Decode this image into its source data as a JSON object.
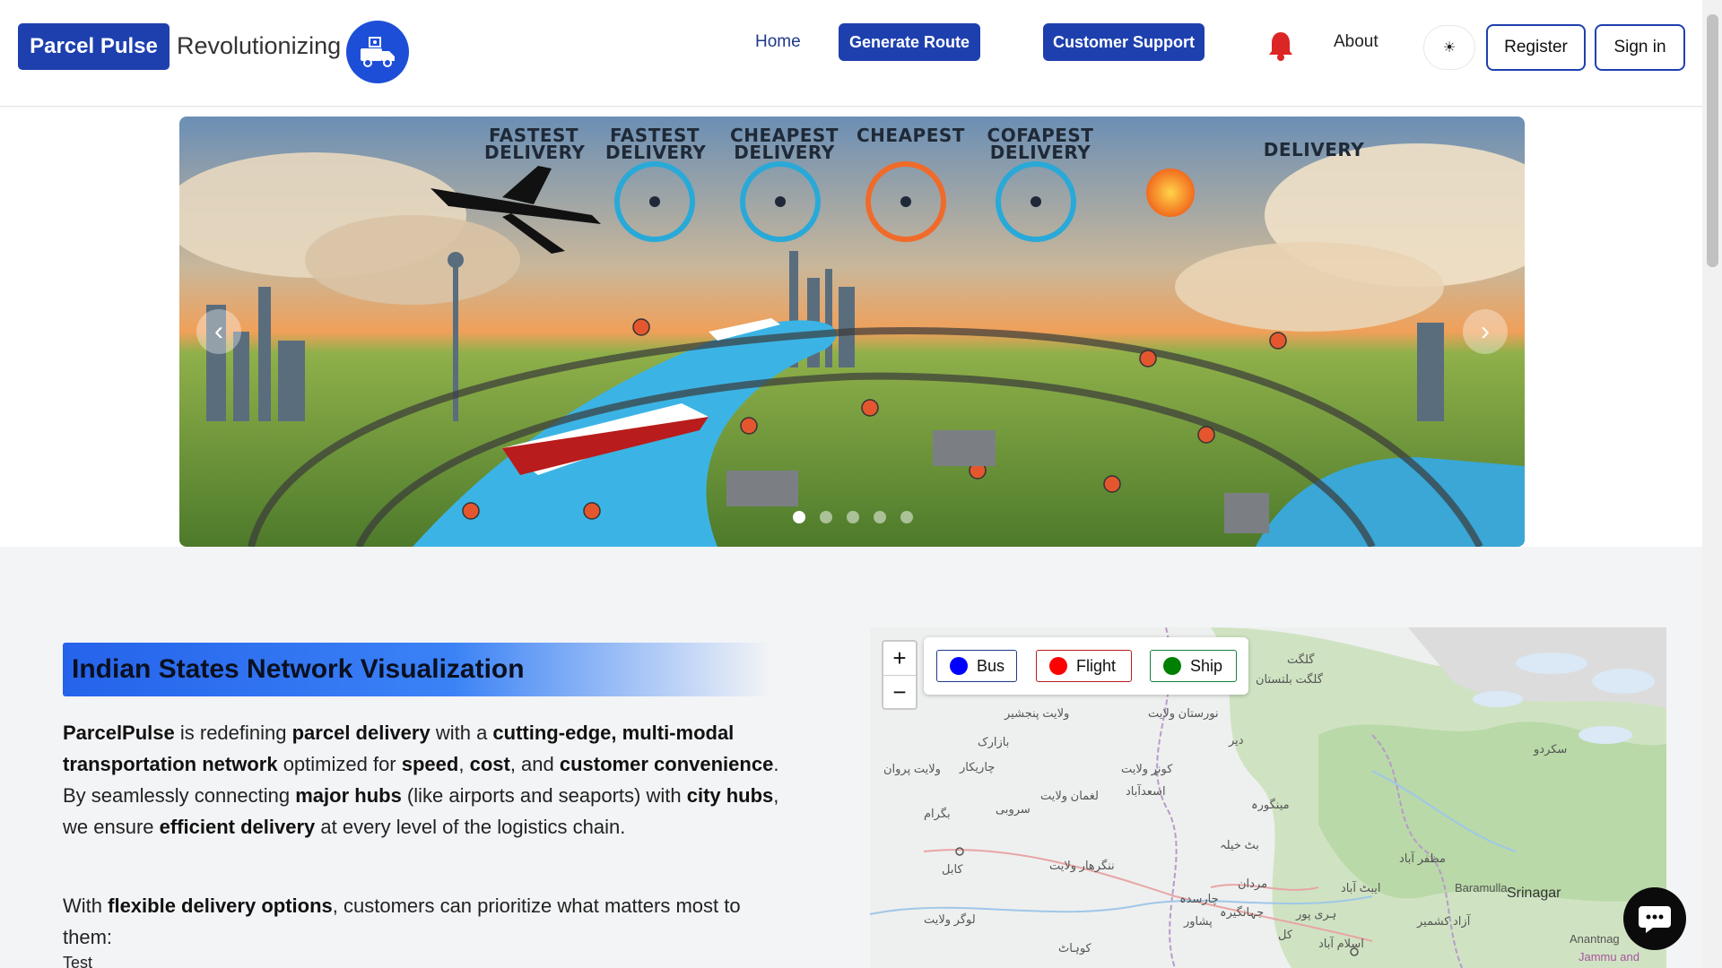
{
  "header": {
    "brand": "Parcel Pulse",
    "tagline": "Revolutionizing",
    "nav": {
      "home": "Home",
      "generate_route": "Generate Route",
      "customer_support": "Customer Support",
      "about": "About",
      "theme_icon": "☀",
      "register": "Register",
      "sign_in": "Sign in"
    }
  },
  "hero": {
    "labels": [
      "FASTEST DELIVERY",
      "FASTEST DELIVERY",
      "CHEAPEST DELIVERY",
      "CHEAPEST",
      "COFAPEST DELIVERY",
      "DELIVERY"
    ],
    "prev": "‹",
    "next": "›",
    "slide_count": 5,
    "active_slide": 0
  },
  "section": {
    "title": "Indian States Network Visualization",
    "p1": {
      "brand": "ParcelPulse",
      "t1": " is redefining ",
      "b1": "parcel delivery",
      "t2": " with a ",
      "b2": "cutting-edge, multi-modal transportation network",
      "t3": " optimized for ",
      "b3": "speed",
      "t4": ", ",
      "b4": "cost",
      "t5": ", and ",
      "b5": "customer convenience",
      "t6": ". By seamlessly connecting ",
      "b6": "major hubs",
      "t7": " (like airports and seaports) with ",
      "b7": "city hubs",
      "t8": ", we ensure ",
      "b8": "efficient delivery",
      "t9": " at every level of the logistics chain."
    },
    "p2": {
      "t1": "With ",
      "b1": "flexible delivery options",
      "t2": ", customers can prioritize what matters most to them:"
    },
    "p3": "Test"
  },
  "map": {
    "zoom_in": "+",
    "zoom_out": "−",
    "legend": [
      {
        "label": "Bus",
        "color": "#0000ff",
        "border": "#1e3a8a"
      },
      {
        "label": "Flight",
        "color": "#ff0000",
        "border": "#b91c1c"
      },
      {
        "label": "Ship",
        "color": "#008000",
        "border": "#15803d"
      }
    ],
    "places": {
      "gilgit": "گلگت",
      "gilgit_baltistan": "گلگت بلتستان",
      "nuristan": "نورستان ولایت",
      "panjshir": "ولایت پنجشیر",
      "bazarak": "بازارک",
      "dir": "دیر",
      "skardu": "سکردو",
      "parwan": "ولایت پروان",
      "charikar": "چاریکار",
      "kunar": "کونړ ولایت",
      "laghman": "لغمان ولایت",
      "asadabad": "اسعدآباد",
      "sarobi": "سروبی",
      "mingora": "مینگورہ",
      "bagram": "بگرام",
      "kabul": "کابل",
      "nangarhar": "ننگرهار ولایت",
      "batkhela": "بٹ خیلہ",
      "mardan": "مردان",
      "muzaffarabad": "مظفر آباد",
      "abbottabad": "ایبٹ آباد",
      "baramulla": "Baramulla",
      "srinagar": "Srinagar",
      "charsadda": "چارسدہ",
      "jahangira": "جہانگیرہ",
      "peshawar": "پشاور",
      "kohat": "کوہاٹ",
      "haripur": "ہری پور",
      "azad_kashmir": "آزاد کشمیر",
      "islamabad": "اسلام آباد",
      "logar": "لوگر ولایت",
      "kal": "کل",
      "anantnag": "Anantnag",
      "jammu": "Jammu and"
    }
  }
}
